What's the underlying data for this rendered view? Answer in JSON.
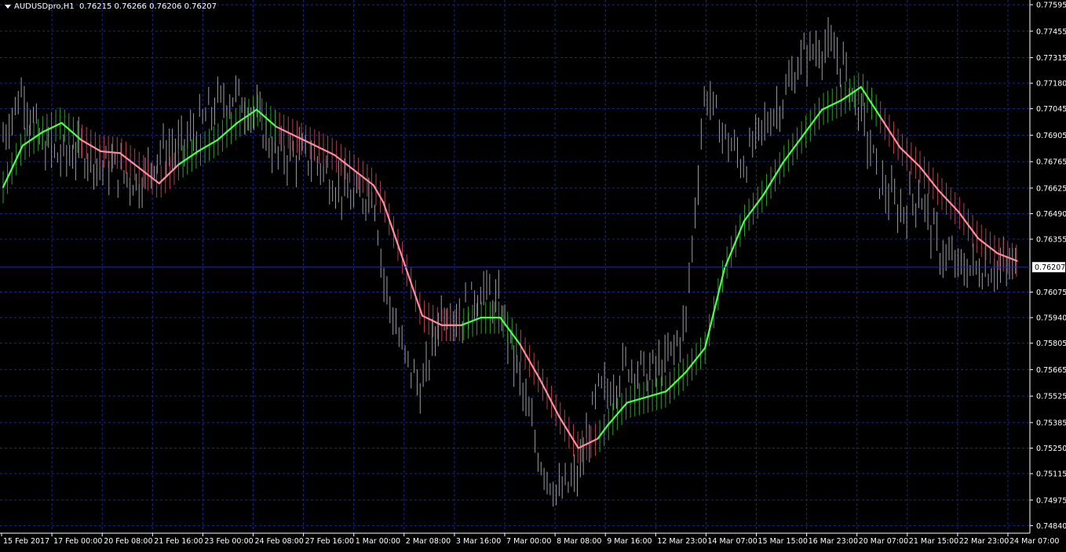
{
  "chart_header": {
    "symbol_timeframe": "AUDUSDpro,H1",
    "ohlc": "0.76215 0.76266 0.76206 0.76207",
    "dropdown_icon": "triangle-down-icon"
  },
  "colors": {
    "background": "#000000",
    "grid": "#1c2a78",
    "axis": "#ffffff",
    "price_bars": "#9a9aa6",
    "bullish_band": "#2e9e2e",
    "bullish_line": "#4cff4c",
    "bearish_band": "#b04050",
    "bearish_line": "#ff8c9c",
    "price_line": "#1f2e9a"
  },
  "chart_data": {
    "type": "line",
    "xlabel": "",
    "ylabel": "",
    "ylim": [
      0.748,
      0.7762
    ],
    "grid": true,
    "y_ticks": [
      "0.77595",
      "0.77455",
      "0.77315",
      "0.77180",
      "0.77045",
      "0.76905",
      "0.76765",
      "0.76625",
      "0.76490",
      "0.76355",
      "0.76075",
      "0.75940",
      "0.75805",
      "0.75665",
      "0.75525",
      "0.75385",
      "0.75250",
      "0.75115",
      "0.74975",
      "0.74840"
    ],
    "x_ticks": [
      "15 Feb 2017",
      "17 Feb 00:00",
      "20 Feb 08:00",
      "21 Feb 16:00",
      "23 Feb 00:00",
      "24 Feb 08:00",
      "27 Feb 16:00",
      "1 Mar 00:00",
      "2 Mar 08:00",
      "3 Mar 16:00",
      "7 Mar 00:00",
      "8 Mar 08:00",
      "9 Mar 16:00",
      "12 Mar 23:00",
      "14 Mar 07:00",
      "15 Mar 15:00",
      "16 Mar 23:00",
      "20 Mar 07:00",
      "21 Mar 15:00",
      "22 Mar 23:00",
      "24 Mar 07:00"
    ],
    "current_price": "0.76207",
    "series": [
      {
        "role": "moving-average",
        "x": [
          0,
          4,
          8,
          12,
          16,
          20,
          24,
          28,
          32,
          36,
          40,
          44,
          48,
          52,
          56,
          60,
          64,
          68,
          72,
          76,
          78,
          82,
          86,
          90,
          94,
          98,
          102,
          106,
          110,
          114,
          118,
          122,
          124,
          128,
          132,
          136,
          140,
          144,
          148,
          152,
          156,
          160,
          164,
          168,
          172,
          176,
          180,
          184,
          188,
          192,
          196,
          200,
          204,
          208
        ],
        "values": [
          0.7663,
          0.7685,
          0.7692,
          0.7697,
          0.7688,
          0.7682,
          0.7681,
          0.7673,
          0.7665,
          0.7675,
          0.7682,
          0.7688,
          0.7697,
          0.7704,
          0.7695,
          0.769,
          0.7685,
          0.768,
          0.7672,
          0.7664,
          0.7655,
          0.7625,
          0.7595,
          0.759,
          0.759,
          0.7594,
          0.7594,
          0.758,
          0.7562,
          0.7542,
          0.7525,
          0.753,
          0.7537,
          0.7549,
          0.7552,
          0.7555,
          0.7565,
          0.7578,
          0.762,
          0.7645,
          0.7659,
          0.7676,
          0.769,
          0.7704,
          0.7709,
          0.7716,
          0.77,
          0.7684,
          0.7674,
          0.7661,
          0.765,
          0.7636,
          0.7628,
          0.7624
        ],
        "trend": [
          "up",
          "up",
          "up",
          "up",
          "down",
          "down",
          "down",
          "down",
          "down",
          "up",
          "up",
          "up",
          "up",
          "up",
          "down",
          "down",
          "down",
          "down",
          "down",
          "down",
          "down",
          "down",
          "down",
          "down",
          "up",
          "up",
          "up",
          "down",
          "down",
          "down",
          "down",
          "up",
          "up",
          "up",
          "up",
          "up",
          "up",
          "up",
          "up",
          "up",
          "up",
          "up",
          "up",
          "up",
          "up",
          "up",
          "down",
          "down",
          "down",
          "down",
          "down",
          "down",
          "down",
          "down"
        ]
      },
      {
        "role": "price-bars",
        "x": [
          0,
          4,
          8,
          12,
          16,
          20,
          24,
          28,
          32,
          36,
          40,
          44,
          48,
          52,
          56,
          60,
          64,
          68,
          72,
          76,
          78,
          82,
          86,
          90,
          94,
          98,
          102,
          106,
          110,
          114,
          118,
          122,
          124,
          128,
          132,
          136,
          140,
          144,
          148,
          152,
          156,
          160,
          164,
          168,
          172,
          176,
          180,
          184,
          188,
          192,
          196,
          200,
          204,
          208
        ],
        "values": [
          0.769,
          0.7715,
          0.7684,
          0.7678,
          0.7682,
          0.7675,
          0.7671,
          0.7664,
          0.7683,
          0.7683,
          0.7695,
          0.7707,
          0.7712,
          0.77,
          0.768,
          0.768,
          0.7678,
          0.7665,
          0.7655,
          0.7662,
          0.7615,
          0.7575,
          0.7555,
          0.76,
          0.7595,
          0.761,
          0.76,
          0.756,
          0.752,
          0.75,
          0.751,
          0.7555,
          0.7555,
          0.757,
          0.7565,
          0.757,
          0.759,
          0.7715,
          0.769,
          0.7675,
          0.7695,
          0.771,
          0.7732,
          0.7738,
          0.773,
          0.77,
          0.7665,
          0.765,
          0.766,
          0.763,
          0.762,
          0.762,
          0.762,
          0.762
        ]
      }
    ]
  }
}
